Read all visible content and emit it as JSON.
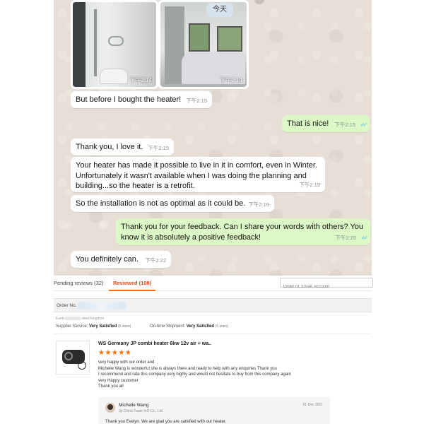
{
  "chat": {
    "today_badge": "今天",
    "media": [
      {
        "time": "下午2:14"
      },
      {
        "time": "下午2:14"
      }
    ],
    "messages": [
      {
        "text": "But before I bought the heater!",
        "time": "下午2:15"
      },
      {
        "text": "That is nice!",
        "time": "下午2:15",
        "ticks": "✓✓"
      },
      {
        "text": "Thank you, I love it.",
        "time": "下午2:15"
      },
      {
        "text": "Your heater has made it possible to live in it in comfort, even in Winter. Unfortunately it wasn't available when I was doing the planning and building...so the heater is a retrofit.",
        "time": "下午2:19"
      },
      {
        "text": "So the installation is not as optimal as it could be.",
        "time": "下午2:19"
      },
      {
        "text": "Thank you for your feedback. Can I share your words with others? You know it is absolutely a positive feedback!",
        "time": "下午2:20",
        "ticks": "✓✓"
      },
      {
        "text": "You definitely can.",
        "time": "下午2:22"
      }
    ]
  },
  "reviews": {
    "tabs": [
      "Pending reviews (32)",
      "Reviewed (108)"
    ],
    "search_placeholder": "Order Id, Email, Account",
    "order_label": "Order No.",
    "buyer_prefix": "Evely",
    "buyer_suffix": "nited Kingdom",
    "supplier_service_label": "Supplier Service:",
    "supplier_service_value": "Very Satisfied",
    "supplier_service_stars": "(5 stars)",
    "ontime_label": "On-time Shipment:",
    "ontime_value": "Very Satisfied",
    "ontime_stars": "(5 stars)",
    "product_title": "WS Germany JP combi heater 6kw 12v air + wa..",
    "rating": "★★★★★",
    "review_lines": [
      "very happy with our order and",
      "Michelle Wang is wonderful she is always there and ready to help with any enquiries Thank you",
      "I recommend and rate this company very highly and would not hesitate to buy from this company again",
      "very Happy customer",
      "Thank you all"
    ],
    "reply": {
      "name": "Michelle Wang",
      "company": "Jp China Trade Int'l Co., Ltd",
      "date": "01 Dec 2021",
      "text": "Thank you Evelyn. We are glad you are satisfied with our heater."
    }
  },
  "colors": {
    "chat_bg": "#e7dfd5",
    "outgoing_bubble": "#dcf8c6",
    "accent_orange": "#ff6a00",
    "read_ticks": "#4fb6ec"
  }
}
